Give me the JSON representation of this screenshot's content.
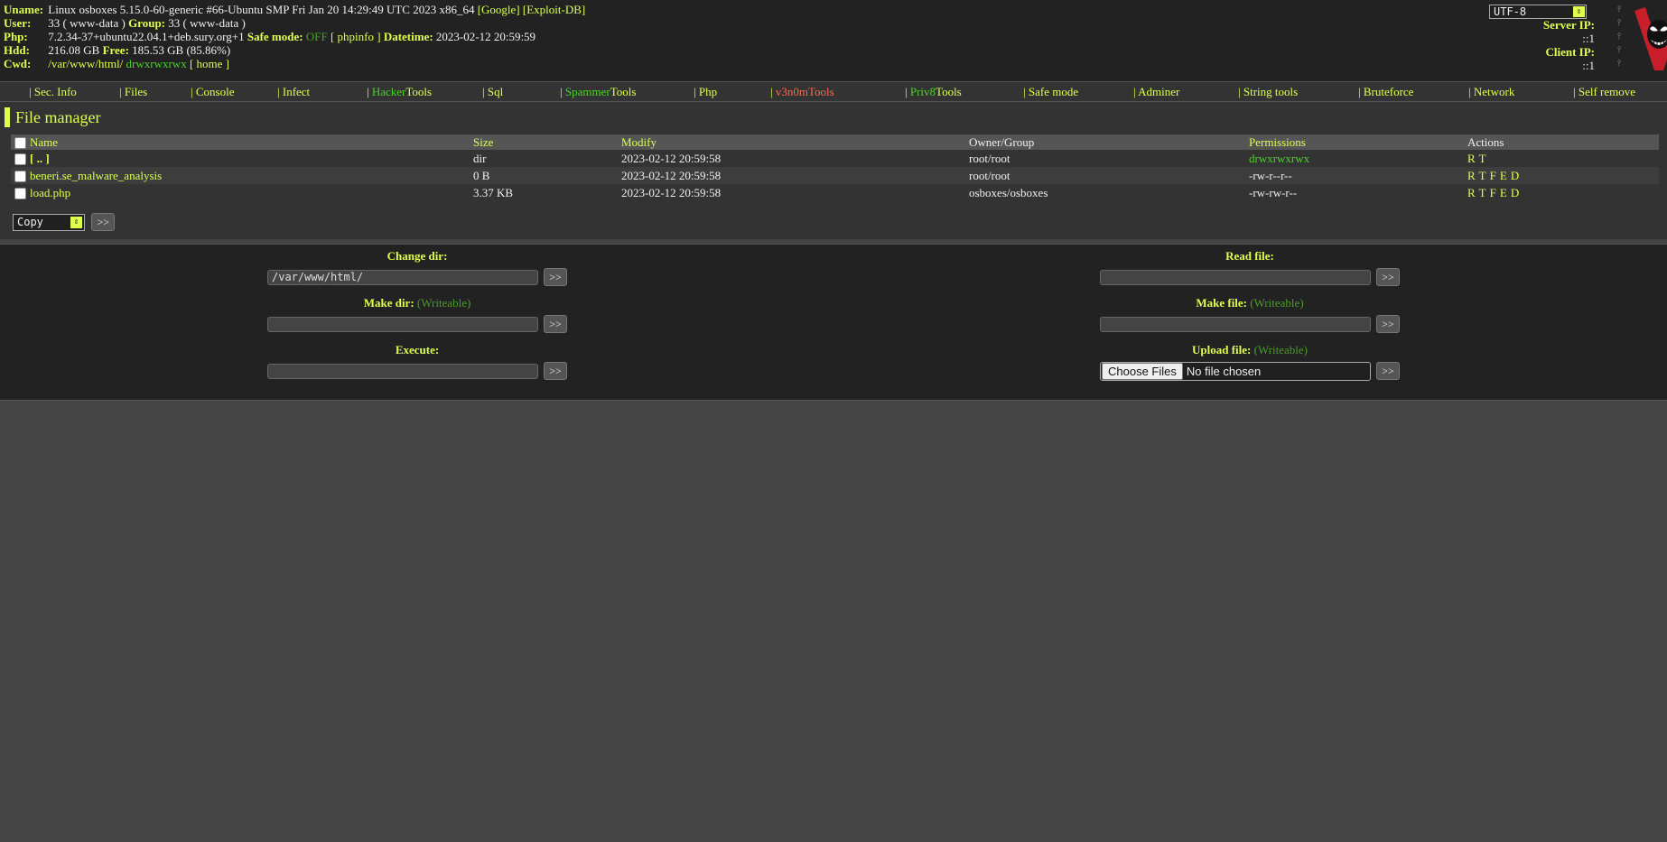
{
  "header": {
    "uname_label": "Uname:",
    "uname": "Linux osboxes 5.15.0-60-generic #66-Ubuntu SMP Fri Jan 20 14:29:49 UTC 2023 x86_64",
    "google_link": "[Google]",
    "exploitdb_link": "[Exploit-DB]",
    "user_label": "User:",
    "user": "33 ( www-data )",
    "group_label": "Group:",
    "group": "33 ( www-data )",
    "php_label": "Php:",
    "php": "7.2.34-37+ubuntu22.04.1+deb.sury.org+1",
    "safe_mode_label": "Safe mode:",
    "safe_mode": "OFF",
    "phpinfo_link": "[ phpinfo ]",
    "datetime_label": "Datetime:",
    "datetime": "2023-02-12 20:59:59",
    "hdd_label": "Hdd:",
    "hdd": "216.08 GB",
    "free_label": "Free:",
    "free": "185.53 GB (85.86%)",
    "cwd_label": "Cwd:",
    "cwd": "/var/www/html/",
    "cwd_perms": "drwxrwxrwx",
    "home_link": "[ home ]",
    "charset": "UTF-8",
    "server_ip_label": "Server IP:",
    "server_ip": "::1",
    "client_ip_label": "Client IP:",
    "client_ip": "::1"
  },
  "menu": [
    {
      "bar": "| ",
      "a": "Sec. Info",
      "b": ""
    },
    {
      "bar": "| ",
      "a": "Files",
      "b": ""
    },
    {
      "bar": "| ",
      "a": "Console",
      "b": ""
    },
    {
      "bar": "| ",
      "a": "Infect",
      "b": ""
    },
    {
      "bar": "| ",
      "a": "Hacker",
      "b": "Tools"
    },
    {
      "bar": "| ",
      "a": "Sql",
      "b": ""
    },
    {
      "bar": "| ",
      "a": "Spammer",
      "b": "Tools"
    },
    {
      "bar": "| ",
      "a": "Php",
      "b": ""
    },
    {
      "bar": "| ",
      "a": "v3n0mTools",
      "b": ""
    },
    {
      "bar": "| ",
      "a": "Priv8",
      "b": "Tools"
    },
    {
      "bar": "| ",
      "a": "Safe mode",
      "b": ""
    },
    {
      "bar": "| ",
      "a": "Adminer",
      "b": ""
    },
    {
      "bar": "| ",
      "a": "String tools",
      "b": ""
    },
    {
      "bar": "| ",
      "a": "Bruteforce",
      "b": ""
    },
    {
      "bar": "| ",
      "a": "Network",
      "b": ""
    },
    {
      "bar": "| ",
      "a": "Self remove",
      "b": ""
    }
  ],
  "file_manager": {
    "title": "File manager",
    "columns": [
      "Name",
      "Size",
      "Modify",
      "Owner/Group",
      "Permissions",
      "Actions"
    ],
    "rows": [
      {
        "name": "[ .. ]",
        "size": "dir",
        "modify": "2023-02-12 20:59:58",
        "owner": "root/root",
        "perms": "drwxrwxrwx",
        "actions": [
          "R",
          "T"
        ]
      },
      {
        "name": "beneri.se_malware_analysis",
        "size": "0 B",
        "modify": "2023-02-12 20:59:58",
        "owner": "root/root",
        "perms": "-rw-r--r--",
        "actions": [
          "R",
          "T",
          "F",
          "E",
          "D"
        ]
      },
      {
        "name": "load.php",
        "size": "3.37 KB",
        "modify": "2023-02-12 20:59:58",
        "owner": "osboxes/osboxes",
        "perms": "-rw-rw-r--",
        "actions": [
          "R",
          "T",
          "F",
          "E",
          "D"
        ]
      }
    ],
    "bulk_action": "Copy",
    "go_label": ">>"
  },
  "forms": {
    "change_dir_label": "Change dir:",
    "change_dir_value": "/var/www/html/",
    "read_file_label": "Read file:",
    "make_dir_label": "Make dir:",
    "make_file_label": "Make file:",
    "writeable": "(Writeable)",
    "execute_label": "Execute:",
    "upload_label": "Upload file:",
    "choose_files": "Choose Files",
    "no_file": "No file chosen",
    "go_label": ">>"
  }
}
